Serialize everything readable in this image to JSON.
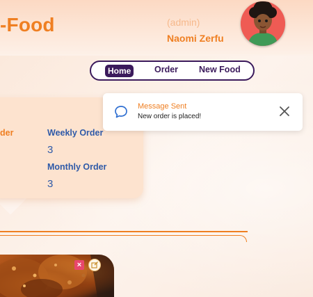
{
  "header": {
    "brand": "-Food",
    "role": "(admin)",
    "user_name": "Naomi Zerfu"
  },
  "nav": {
    "items": [
      "Home",
      "Order",
      "New Food"
    ],
    "active": "Home"
  },
  "stats": {
    "partial_label": "der",
    "weekly_label": "Weekly Order",
    "weekly_value": "3",
    "monthly_label": "Monthly Order",
    "monthly_value": "3"
  },
  "toast": {
    "title": "Message Sent",
    "message": "New order is placed!",
    "icon": "chat-bubble-icon",
    "close_icon": "close-icon"
  },
  "food_card": {
    "delete_icon": "delete-icon",
    "edit_icon": "edit-icon"
  },
  "colors": {
    "accent": "#ef7f22",
    "nav_dark": "#3b1a5c",
    "stat_blue": "#2f5aa8",
    "delete_pink": "#e8476d"
  }
}
